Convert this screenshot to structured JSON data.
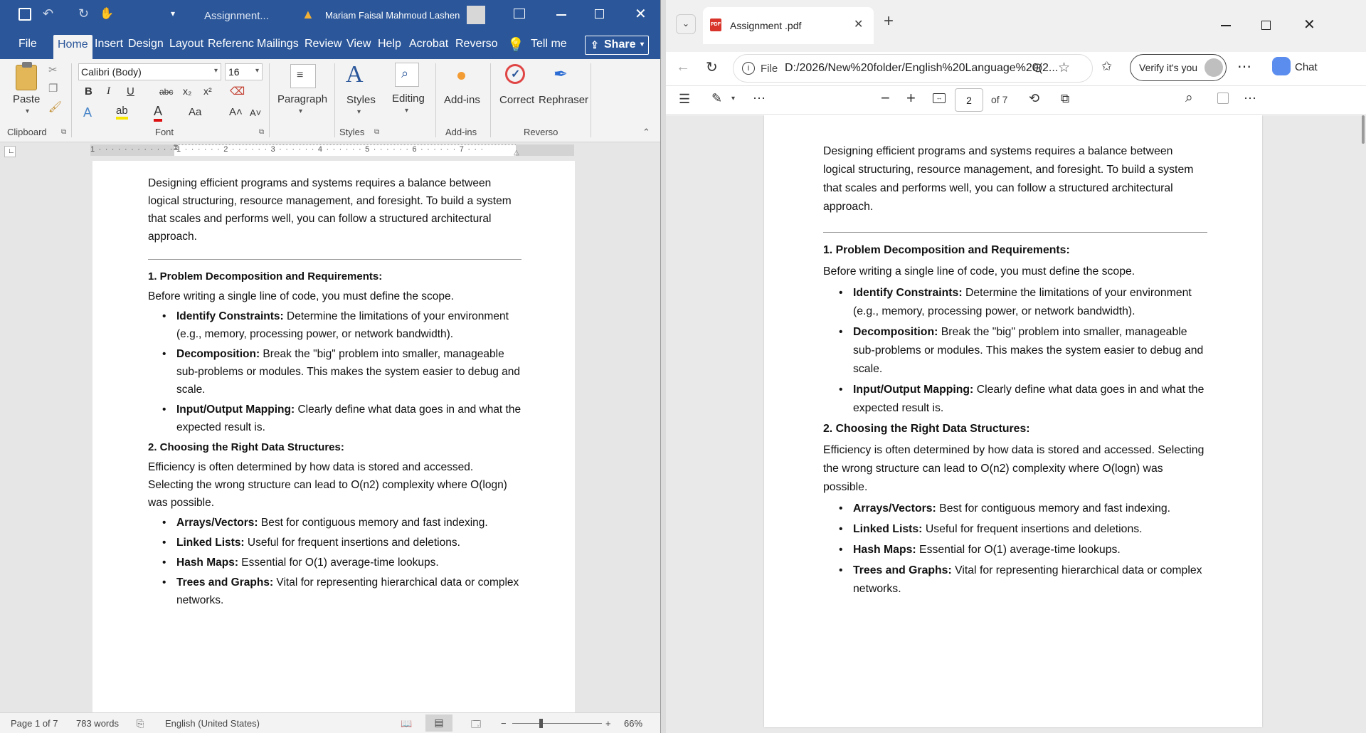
{
  "word": {
    "title": {
      "doc_name": "Assignment...",
      "user_name": "Mariam Faisal Mahmoud Lashen"
    },
    "tabs": [
      "File",
      "Home",
      "Insert",
      "Design",
      "Layout",
      "Referenc",
      "Mailings",
      "Review",
      "View",
      "Help",
      "Acrobat",
      "Reverso"
    ],
    "tell_me": "Tell me",
    "share_label": "Share",
    "ribbon": {
      "paste": "Paste",
      "clipboard": "Clipboard",
      "font_name": "Calibri (Body)",
      "font_size": "16",
      "font": "Font",
      "paragraph": "Paragraph",
      "styles_btn": "Styles",
      "styles": "Styles",
      "editing": "Editing",
      "addins_btn": "Add-ins",
      "addins": "Add-ins",
      "correct": "Correct",
      "rephraser": "Rephraser",
      "reverso": "Reverso"
    },
    "status": {
      "page": "Page 1 of 7",
      "words": "783 words",
      "language": "English (United States)",
      "zoom": "66%"
    }
  },
  "document": {
    "intro": "Designing efficient programs and systems requires a balance between logical structuring, resource management, and foresight. To build a system that scales and performs well, you can follow a structured architectural approach.",
    "h1": "1. Problem Decomposition and Requirements:",
    "p1": "Before writing a single line of code, you must define the scope.",
    "list1": [
      {
        "term": "Identify Constraints:",
        "text": " Determine the limitations of your environment (e.g., memory, processing power, or network bandwidth)."
      },
      {
        "term": "Decomposition:",
        "text": " Break the \"big\" problem into smaller, manageable sub-problems or modules. This makes the system easier to debug and scale."
      },
      {
        "term": "Input/Output Mapping:",
        "text": " Clearly define what data goes in and what the expected result is."
      }
    ],
    "h2": "2. Choosing the Right Data Structures:",
    "p2_word": "Efficiency is often determined by how data is stored and accessed. Selecting the wrong structure can lead to O(n2) complexity where O(logn) was possible.",
    "p2_pdf": "Efficiency is often determined by how data is stored and accessed. Selecting the wrong structure can lead to O(n2) complexity where O(logn) was possible.",
    "list2": [
      {
        "term": "Arrays/Vectors:",
        "text": " Best for contiguous memory and fast indexing."
      },
      {
        "term": "Linked Lists:",
        "text": " Useful for frequent insertions and deletions."
      },
      {
        "term": "Hash Maps:",
        "text": " Essential for O(1) average-time lookups."
      },
      {
        "term": "Trees and Graphs:",
        "text": " Vital for representing hierarchical data or complex networks."
      }
    ]
  },
  "pdf": {
    "tab_title": "Assignment .pdf",
    "address_label": "File",
    "address": "D:/2026/New%20folder/English%20Language%20(2...",
    "verify": "Verify it's you",
    "chat": "Chat",
    "page_input": "2",
    "page_total": "of 7"
  }
}
